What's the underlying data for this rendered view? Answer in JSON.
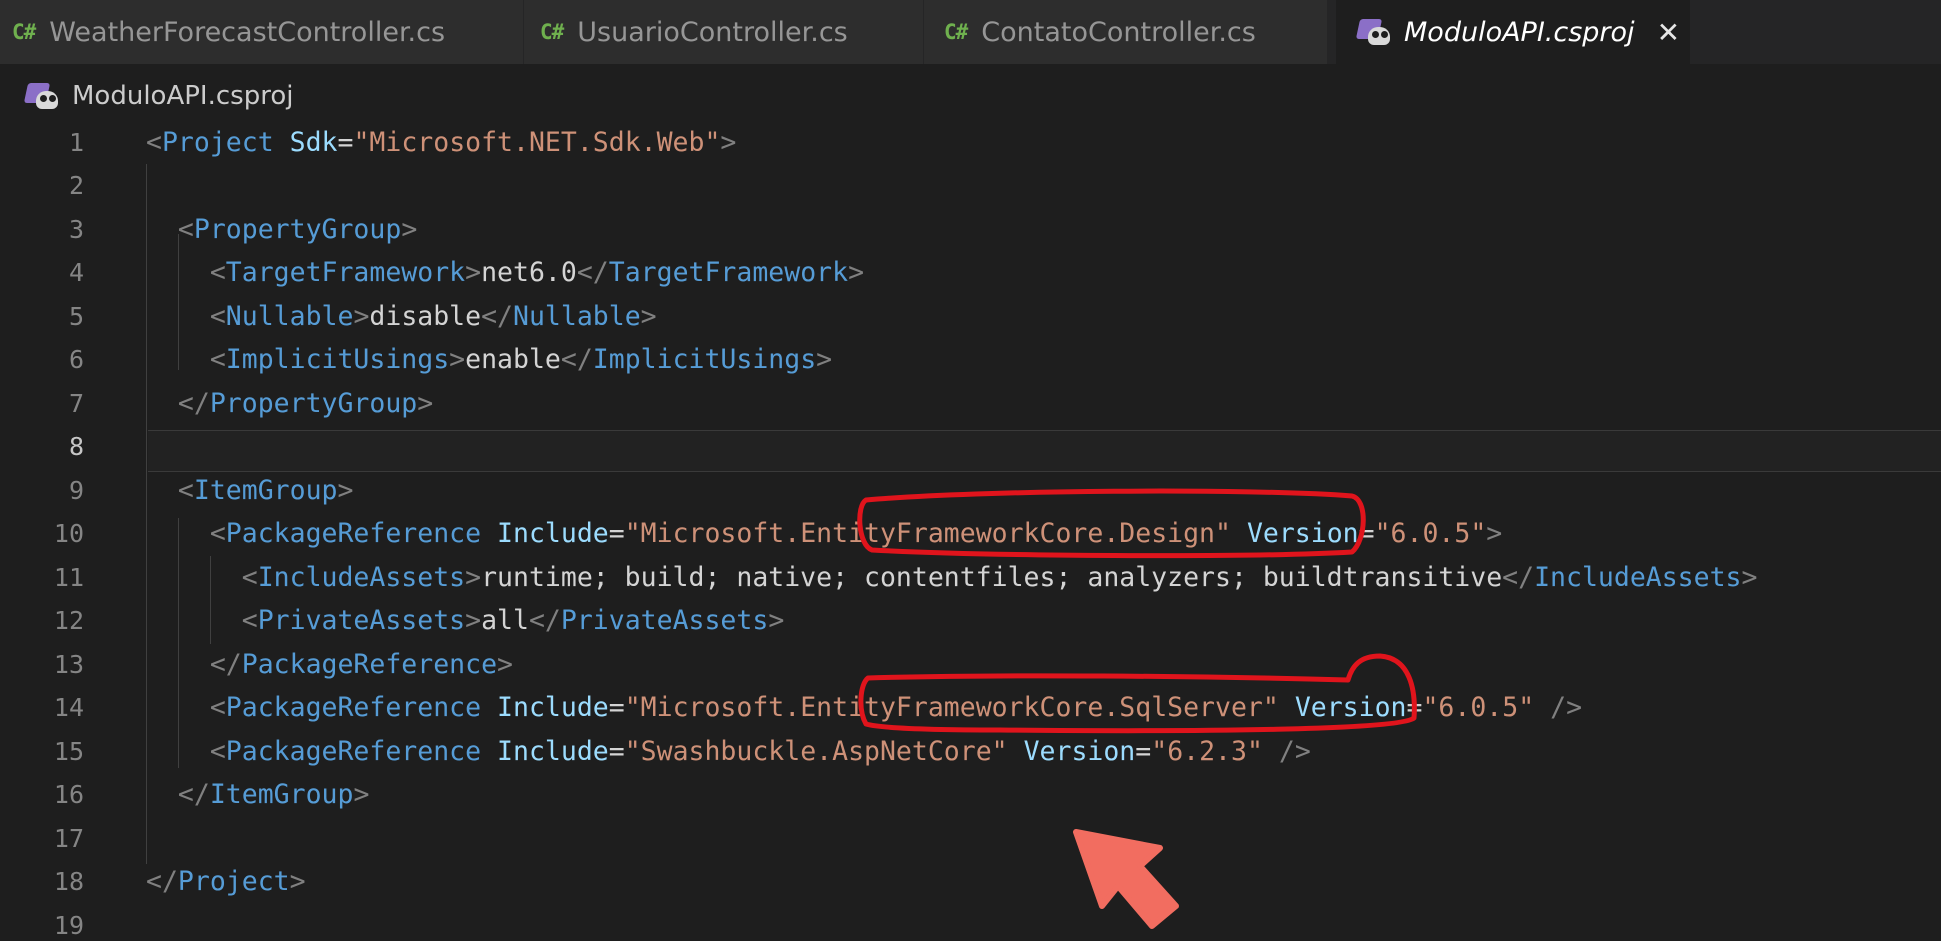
{
  "tabs": [
    {
      "label": "WeatherForecastController.cs",
      "icon": "csharp-file-icon",
      "active": false
    },
    {
      "label": "UsuarioController.cs",
      "icon": "csharp-file-icon",
      "active": false
    },
    {
      "label": "ContatoController.cs",
      "icon": "csharp-file-icon",
      "active": false
    },
    {
      "label": "ModuloAPI.csproj",
      "icon": "csproj-file-icon",
      "active": true
    }
  ],
  "tab_icon_text": "C#",
  "close_glyph": "✕",
  "breadcrumb": {
    "icon": "csproj-file-icon",
    "label": "ModuloAPI.csproj"
  },
  "current_line": 8,
  "lines": [
    {
      "n": "1",
      "tokens": [
        [
          "p",
          "<"
        ],
        [
          "tg",
          "Project"
        ],
        [
          "t",
          " "
        ],
        [
          "at",
          "Sdk"
        ],
        [
          "t",
          "="
        ],
        [
          "s",
          "\"Microsoft.NET.Sdk.Web\""
        ],
        [
          "p",
          ">"
        ]
      ]
    },
    {
      "n": "2",
      "tokens": []
    },
    {
      "n": "3",
      "tokens": [
        [
          "t",
          "  "
        ],
        [
          "p",
          "<"
        ],
        [
          "tg",
          "PropertyGroup"
        ],
        [
          "p",
          ">"
        ]
      ]
    },
    {
      "n": "4",
      "tokens": [
        [
          "t",
          "    "
        ],
        [
          "p",
          "<"
        ],
        [
          "tg",
          "TargetFramework"
        ],
        [
          "p",
          ">"
        ],
        [
          "t",
          "net6.0"
        ],
        [
          "p",
          "</"
        ],
        [
          "tg",
          "TargetFramework"
        ],
        [
          "p",
          ">"
        ]
      ]
    },
    {
      "n": "5",
      "tokens": [
        [
          "t",
          "    "
        ],
        [
          "p",
          "<"
        ],
        [
          "tg",
          "Nullable"
        ],
        [
          "p",
          ">"
        ],
        [
          "t",
          "disable"
        ],
        [
          "p",
          "</"
        ],
        [
          "tg",
          "Nullable"
        ],
        [
          "p",
          ">"
        ]
      ]
    },
    {
      "n": "6",
      "tokens": [
        [
          "t",
          "    "
        ],
        [
          "p",
          "<"
        ],
        [
          "tg",
          "ImplicitUsings"
        ],
        [
          "p",
          ">"
        ],
        [
          "t",
          "enable"
        ],
        [
          "p",
          "</"
        ],
        [
          "tg",
          "ImplicitUsings"
        ],
        [
          "p",
          ">"
        ]
      ]
    },
    {
      "n": "7",
      "tokens": [
        [
          "t",
          "  "
        ],
        [
          "p",
          "</"
        ],
        [
          "tg",
          "PropertyGroup"
        ],
        [
          "p",
          ">"
        ]
      ]
    },
    {
      "n": "8",
      "tokens": []
    },
    {
      "n": "9",
      "tokens": [
        [
          "t",
          "  "
        ],
        [
          "p",
          "<"
        ],
        [
          "tg",
          "ItemGroup"
        ],
        [
          "p",
          ">"
        ]
      ]
    },
    {
      "n": "10",
      "tokens": [
        [
          "t",
          "    "
        ],
        [
          "p",
          "<"
        ],
        [
          "tg",
          "PackageReference"
        ],
        [
          "t",
          " "
        ],
        [
          "at",
          "Include"
        ],
        [
          "t",
          "="
        ],
        [
          "s",
          "\"Microsoft.EntityFrameworkCore.Design\""
        ],
        [
          "t",
          " "
        ],
        [
          "at",
          "Version"
        ],
        [
          "t",
          "="
        ],
        [
          "s",
          "\"6.0.5\""
        ],
        [
          "p",
          ">"
        ]
      ]
    },
    {
      "n": "11",
      "tokens": [
        [
          "t",
          "      "
        ],
        [
          "p",
          "<"
        ],
        [
          "tg",
          "IncludeAssets"
        ],
        [
          "p",
          ">"
        ],
        [
          "t",
          "runtime; build; native; contentfiles; analyzers; buildtransitive"
        ],
        [
          "p",
          "</"
        ],
        [
          "tg",
          "IncludeAssets"
        ],
        [
          "p",
          ">"
        ]
      ]
    },
    {
      "n": "12",
      "tokens": [
        [
          "t",
          "      "
        ],
        [
          "p",
          "<"
        ],
        [
          "tg",
          "PrivateAssets"
        ],
        [
          "p",
          ">"
        ],
        [
          "t",
          "all"
        ],
        [
          "p",
          "</"
        ],
        [
          "tg",
          "PrivateAssets"
        ],
        [
          "p",
          ">"
        ]
      ]
    },
    {
      "n": "13",
      "tokens": [
        [
          "t",
          "    "
        ],
        [
          "p",
          "</"
        ],
        [
          "tg",
          "PackageReference"
        ],
        [
          "p",
          ">"
        ]
      ]
    },
    {
      "n": "14",
      "tokens": [
        [
          "t",
          "    "
        ],
        [
          "p",
          "<"
        ],
        [
          "tg",
          "PackageReference"
        ],
        [
          "t",
          " "
        ],
        [
          "at",
          "Include"
        ],
        [
          "t",
          "="
        ],
        [
          "s",
          "\"Microsoft.EntityFrameworkCore.SqlServer\""
        ],
        [
          "t",
          " "
        ],
        [
          "at",
          "Version"
        ],
        [
          "t",
          "="
        ],
        [
          "s",
          "\"6.0.5\""
        ],
        [
          "t",
          " "
        ],
        [
          "p",
          "/>"
        ]
      ]
    },
    {
      "n": "15",
      "tokens": [
        [
          "t",
          "    "
        ],
        [
          "p",
          "<"
        ],
        [
          "tg",
          "PackageReference"
        ],
        [
          "t",
          " "
        ],
        [
          "at",
          "Include"
        ],
        [
          "t",
          "="
        ],
        [
          "s",
          "\"Swashbuckle.AspNetCore\""
        ],
        [
          "t",
          " "
        ],
        [
          "at",
          "Version"
        ],
        [
          "t",
          "="
        ],
        [
          "s",
          "\"6.2.3\""
        ],
        [
          "t",
          " "
        ],
        [
          "p",
          "/>"
        ]
      ]
    },
    {
      "n": "16",
      "tokens": [
        [
          "t",
          "  "
        ],
        [
          "p",
          "</"
        ],
        [
          "tg",
          "ItemGroup"
        ],
        [
          "p",
          ">"
        ]
      ]
    },
    {
      "n": "17",
      "tokens": []
    },
    {
      "n": "18",
      "tokens": [
        [
          "p",
          "</"
        ],
        [
          "tg",
          "Project"
        ],
        [
          "p",
          ">"
        ]
      ]
    },
    {
      "n": "19",
      "tokens": []
    }
  ],
  "colors": {
    "editor_bg": "#1e1e1e",
    "tag": "#569cd6",
    "attribute": "#9cdcfe",
    "string": "#ce9178",
    "punctuation": "#808080",
    "text": "#d4d4d4",
    "annotation_circle": "#e0141c",
    "annotation_arrow": "#f26d60"
  },
  "annotations": [
    {
      "kind": "hand-drawn-circle",
      "target": "EntityFrameworkCore.Design\"",
      "line": "10"
    },
    {
      "kind": "hand-drawn-circle",
      "target": "EntityFrameworkCore.SqlServer\"",
      "line": "14"
    },
    {
      "kind": "arrow",
      "icon": "pointer-arrow-icon"
    }
  ]
}
